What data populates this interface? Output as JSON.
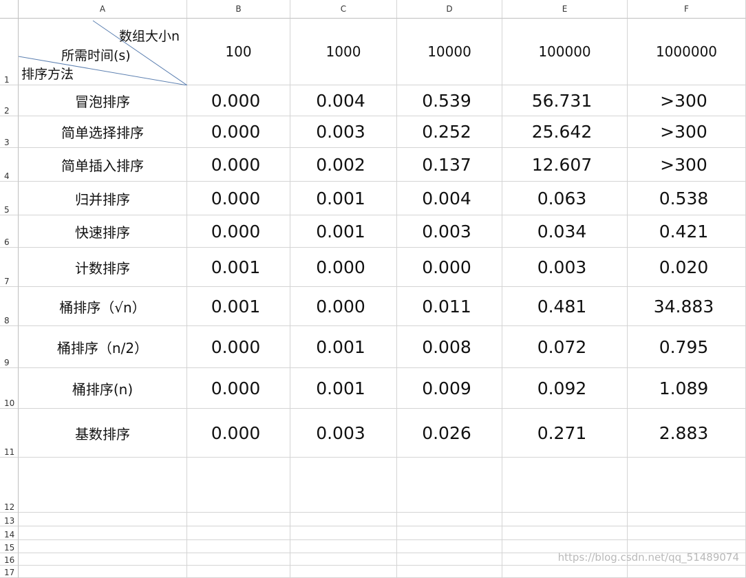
{
  "columns": [
    "A",
    "B",
    "C",
    "D",
    "E",
    "F"
  ],
  "row_numbers": [
    "1",
    "2",
    "3",
    "4",
    "5",
    "6",
    "7",
    "8",
    "9",
    "10",
    "11",
    "12",
    "13",
    "14",
    "15",
    "16",
    "17"
  ],
  "header_cell": {
    "size_label": "数组大小n",
    "time_label": "所需时间(s)",
    "method_label": "排序方法"
  },
  "sizes": [
    "100",
    "1000",
    "10000",
    "100000",
    "1000000"
  ],
  "rows": [
    {
      "method": "冒泡排序",
      "values": [
        "0.000",
        "0.004",
        "0.539",
        "56.731",
        ">300"
      ]
    },
    {
      "method": "简单选择排序",
      "values": [
        "0.000",
        "0.003",
        "0.252",
        "25.642",
        ">300"
      ]
    },
    {
      "method": "简单插入排序",
      "values": [
        "0.000",
        "0.002",
        "0.137",
        "12.607",
        ">300"
      ]
    },
    {
      "method": "归并排序",
      "values": [
        "0.000",
        "0.001",
        "0.004",
        "0.063",
        "0.538"
      ]
    },
    {
      "method": "快速排序",
      "values": [
        "0.000",
        "0.001",
        "0.003",
        "0.034",
        "0.421"
      ]
    },
    {
      "method": "计数排序",
      "values": [
        "0.001",
        "0.000",
        "0.000",
        "0.003",
        "0.020"
      ]
    },
    {
      "method": "桶排序（√n）",
      "values": [
        "0.001",
        "0.000",
        "0.011",
        "0.481",
        "34.883"
      ]
    },
    {
      "method": "桶排序（n/2）",
      "values": [
        "0.000",
        "0.001",
        "0.008",
        "0.072",
        "0.795"
      ]
    },
    {
      "method": "桶排序(n)",
      "values": [
        "0.000",
        "0.001",
        "0.009",
        "0.092",
        "1.089"
      ]
    },
    {
      "method": "基数排序",
      "values": [
        "0.000",
        "0.003",
        "0.026",
        "0.271",
        "2.883"
      ]
    }
  ],
  "watermark": "https://blog.csdn.net/qq_51489074",
  "colors": {
    "grid": "#d4d4d4",
    "diagonal": "#5b7fb0",
    "watermark": "#b9b9b9"
  }
}
